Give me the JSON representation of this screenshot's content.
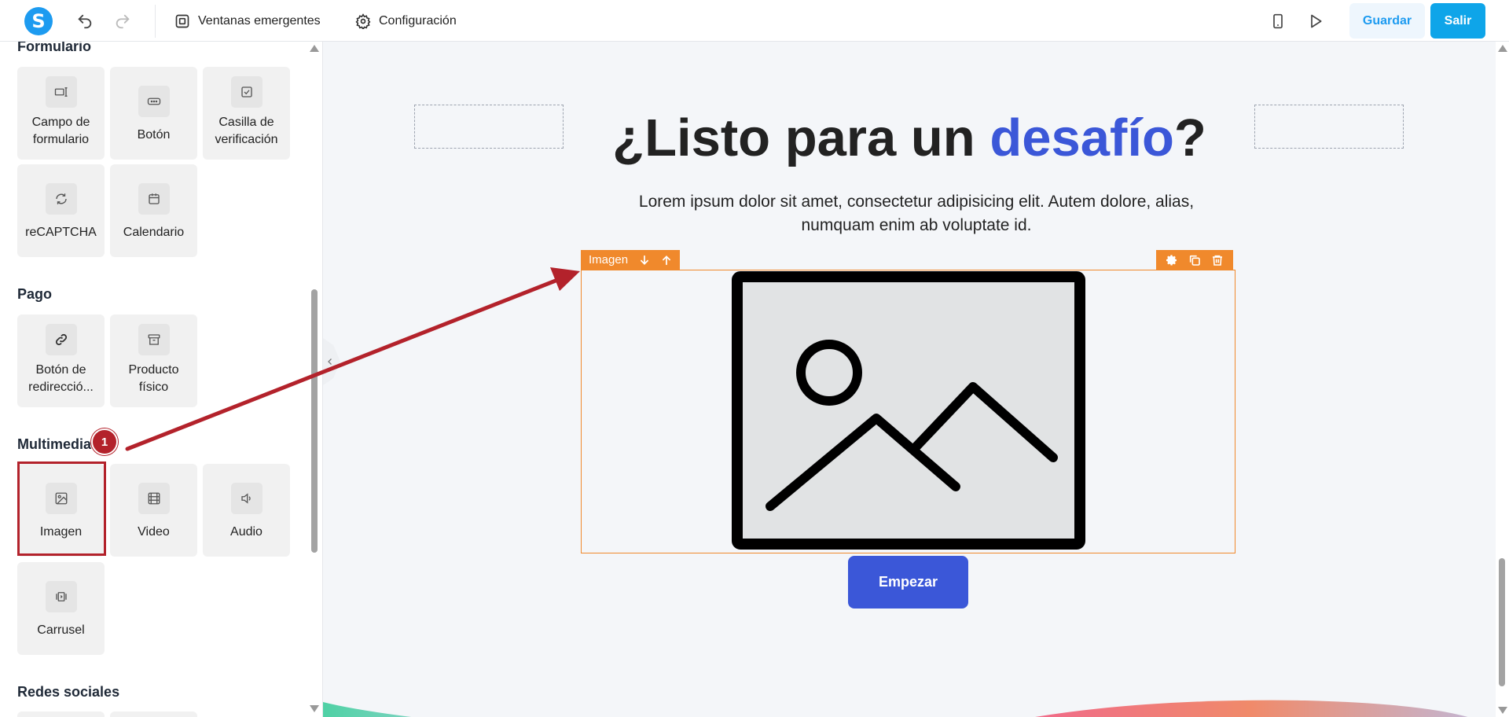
{
  "topbar": {
    "popups_label": "Ventanas emergentes",
    "settings_label": "Configuración",
    "save_label": "Guardar",
    "exit_label": "Salir"
  },
  "sidebar": {
    "sections": {
      "form": "Formulario",
      "payment": "Pago",
      "media": "Multimedia",
      "social": "Redes sociales"
    },
    "form_items": {
      "field": [
        "Campo de",
        "formulario"
      ],
      "button": "Botón",
      "checkbox": [
        "Casilla de",
        "verificación"
      ],
      "recaptcha": "reCAPTCHA",
      "calendar": "Calendario"
    },
    "payment_items": {
      "redirect": [
        "Botón de",
        "redirecció..."
      ],
      "product": [
        "Producto",
        "físico"
      ]
    },
    "media_items": {
      "image": "Imagen",
      "video": "Video",
      "audio": "Audio",
      "carousel": "Carrusel"
    }
  },
  "canvas": {
    "headline_before": "¿Listo para un ",
    "headline_accent": "desafío",
    "headline_after": "?",
    "subtext": "Lorem ipsum dolor sit amet, consectetur adipisicing elit. Autem dolore, alias, numquam enim ab voluptate id.",
    "image_toolbar_label": "Imagen",
    "cta_label": "Empezar"
  },
  "annotation": {
    "step_number": "1"
  },
  "colors": {
    "accent": "#3b57d8",
    "selection": "#f0892c",
    "annotation": "#b3222b",
    "primary": "#0ea5e9"
  }
}
